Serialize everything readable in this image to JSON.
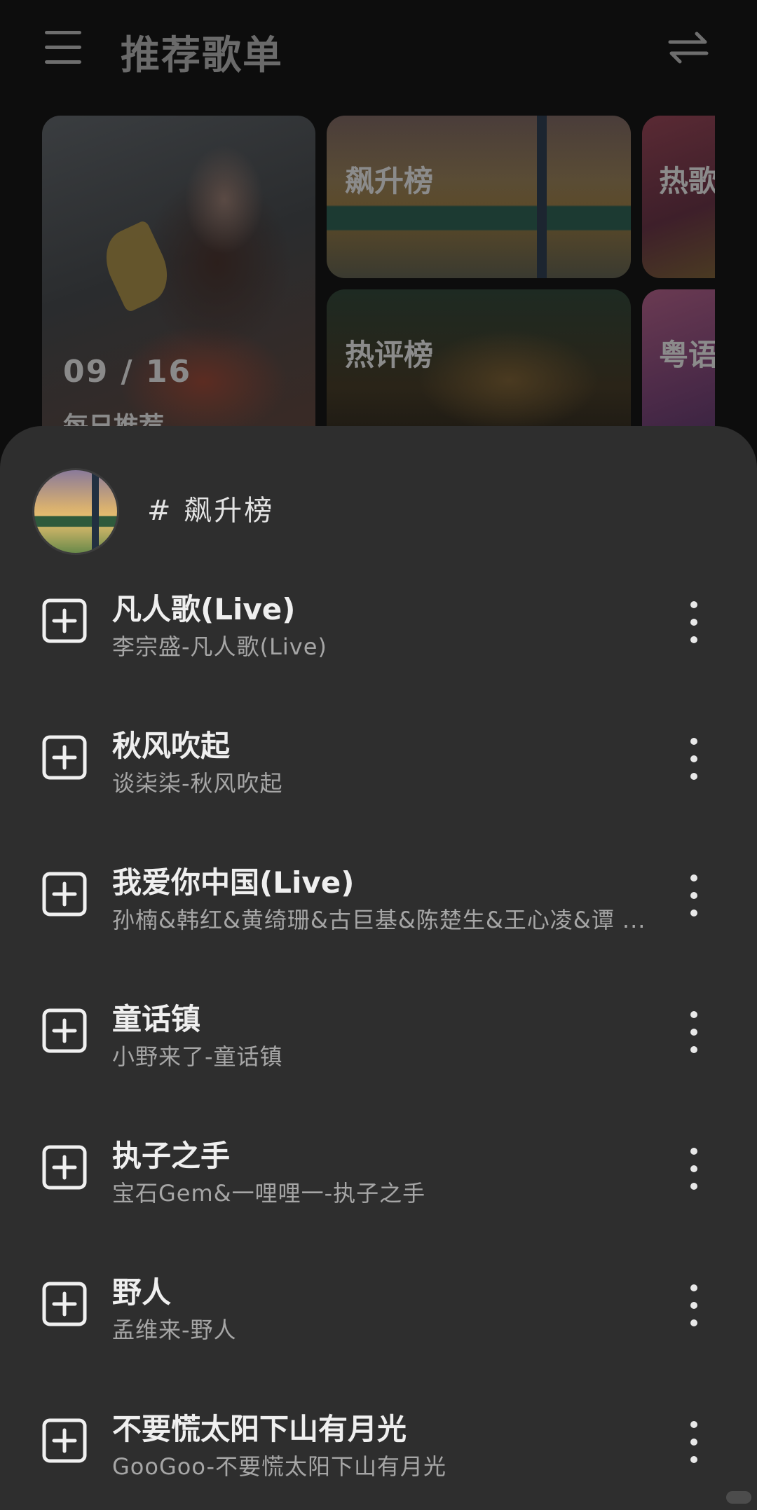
{
  "header": {
    "title": "推荐歌单",
    "menu_icon": "hamburger-menu-icon",
    "swap_icon": "swap-arrows-icon"
  },
  "cards": {
    "daily": {
      "date": "09 / 16",
      "label": "每日推荐"
    },
    "rise": {
      "label": "飙升榜"
    },
    "hot_comment": {
      "label": "热评榜"
    },
    "hot_songs": {
      "label": "热歌"
    },
    "cantonese": {
      "label": "粤语"
    }
  },
  "sheet": {
    "playlist_title": "# 飙升榜",
    "songs": [
      {
        "title": "凡人歌(Live)",
        "subtitle": "李宗盛-凡人歌(Live)"
      },
      {
        "title": "秋风吹起",
        "subtitle": "谈柒柒-秋风吹起"
      },
      {
        "title": "我爱你中国(Live)",
        "subtitle": "孙楠&韩红&黄绮珊&古巨基&陈楚生&王心凌&谭 ..."
      },
      {
        "title": "童话镇",
        "subtitle": "小野来了-童话镇"
      },
      {
        "title": "执子之手",
        "subtitle": "宝石Gem&一哩哩一-执子之手"
      },
      {
        "title": "野人",
        "subtitle": "孟维来-野人"
      },
      {
        "title": "不要慌太阳下山有月光",
        "subtitle": "GooGoo-不要慌太阳下山有月光"
      }
    ]
  },
  "colors": {
    "sheet_bg": "#2e2e2e",
    "title_text": "#efefef",
    "subtitle_text": "#a6a6a6"
  }
}
